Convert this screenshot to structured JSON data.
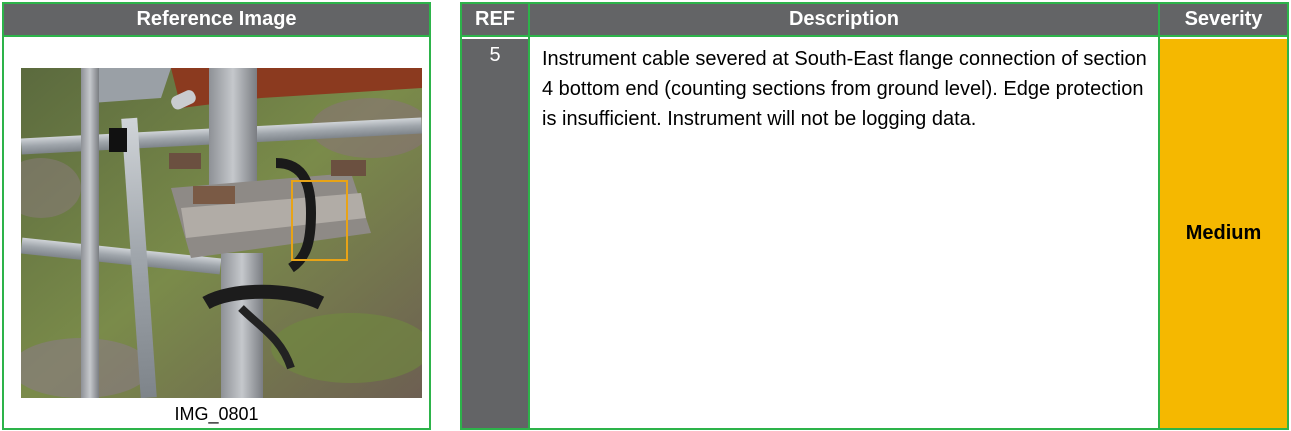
{
  "reference": {
    "header": "Reference Image",
    "caption": "IMG_0801"
  },
  "table": {
    "headers": {
      "ref": "REF",
      "description": "Description",
      "severity": "Severity"
    },
    "row": {
      "ref": "5",
      "description": "Instrument cable severed at South-East flange connection of section 4 bottom end (counting sections from ground level). Edge protection is insufficient.  Instrument will not be logging data.",
      "severity": "Medium"
    }
  },
  "colors": {
    "border": "#2db34a",
    "header_bg": "#636466",
    "severity_medium": "#f5b800",
    "annotation_box": "#e8a317"
  }
}
